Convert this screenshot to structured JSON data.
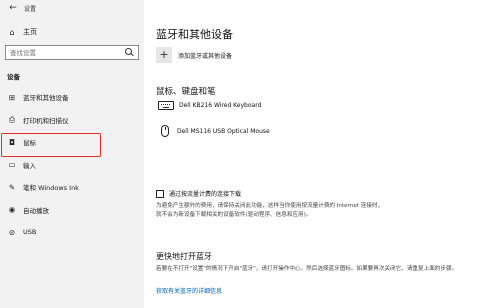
{
  "window": {
    "title": "设置",
    "back_glyph": "←"
  },
  "sidebar": {
    "home_label": "主页",
    "search_placeholder": "查找设置",
    "section_label": "设备",
    "items": [
      {
        "label": "蓝牙和其他设备",
        "icon": "bluetooth-devices-icon",
        "glyph": "⊞"
      },
      {
        "label": "打印机和扫描仪",
        "icon": "printer-icon",
        "glyph": "⎙"
      },
      {
        "label": "鼠标",
        "icon": "mouse-icon",
        "glyph": "◘",
        "selected": true
      },
      {
        "label": "输入",
        "icon": "keyboard-input-icon",
        "glyph": "▭"
      },
      {
        "label": "笔和 Windows Ink",
        "icon": "pen-icon",
        "glyph": "✎"
      },
      {
        "label": "自动播放",
        "icon": "autoplay-icon",
        "glyph": "◉"
      },
      {
        "label": "USB",
        "icon": "usb-icon",
        "glyph": "⊘"
      }
    ]
  },
  "main": {
    "title": "蓝牙和其他设备",
    "add_label": "添加蓝牙或其他设备",
    "add_glyph": "+",
    "group_title": "鼠标、键盘和笔",
    "devices": [
      {
        "name": "Dell KB216 Wired Keyboard",
        "icon": "keyboard-icon"
      },
      {
        "name": "Dell MS116 USB Optical Mouse",
        "icon": "mouse-icon"
      }
    ],
    "metered_checkbox_label": "通过按流量计费的连接下载",
    "metered_checked": false,
    "metered_desc": "为避免产生额外的费用，请保持关闭此功能，这样当你使用按流量计费的 Internet 连接时，就不会为新设备下载相关的设备软件(驱动程序、信息和应用)。",
    "quick_title": "更快地打开蓝牙",
    "quick_desc": "若要在不打开\"设置\"的情况下开启\"蓝牙\"，请打开操作中心，然后选择蓝牙图标。如果要再次关闭它，请重复上面的步骤。",
    "link": "获取有关蓝牙的详细信息"
  },
  "colors": {
    "sidebar_bg": "#f2f2f2",
    "highlight_border": "#e0312b",
    "link": "#0063b1"
  }
}
